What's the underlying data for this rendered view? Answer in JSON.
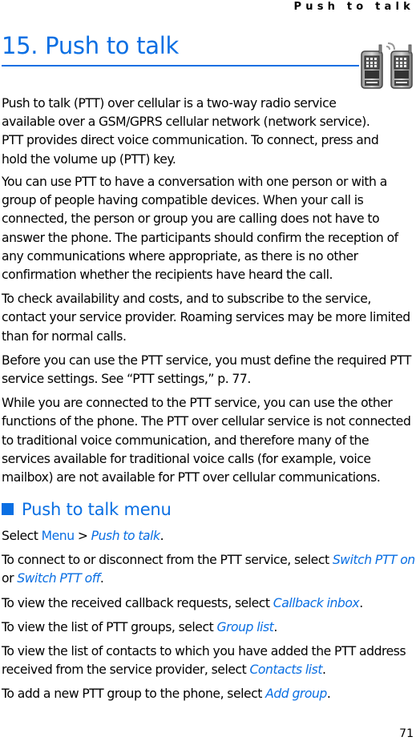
{
  "running_header": "Push to talk",
  "chapter": {
    "number": "15.",
    "title": "Push to talk",
    "icon": "ptt-walkie-talkies-icon"
  },
  "intro_paragraphs": [
    "Push to talk (PTT) over cellular is a two-way radio service available over a GSM/GPRS cellular network (network service). PTT provides direct voice communication. To connect, press and hold the volume up (PTT) key.",
    "You can use PTT to have a conversation with one person or with a group of people having compatible devices. When your call is connected, the person or group you are calling does not have to answer the phone. The participants should confirm the reception of any communications where appropriate, as there is no other confirmation whether the recipients have heard the call.",
    "To check availability and costs, and to subscribe to the service, contact your service provider. Roaming services may be more limited than for normal calls.",
    "Before you can use the PTT service, you must define the required PTT service settings. See “PTT settings,” p. 77.",
    "While you are connected to the PTT service, you can use the other functions of the phone. The PTT over cellular service is not connected to traditional voice communication, and therefore many of the services available for traditional voice calls (for example, voice mailbox) are not available for PTT over cellular communications."
  ],
  "section": {
    "title": "Push to talk menu",
    "select_line": {
      "prefix": "Select ",
      "menu": "Menu",
      "sep": " > ",
      "item": "Push to talk",
      "suffix": "."
    },
    "items": [
      {
        "text": "To connect to or disconnect from the PTT service, select ",
        "option": "Switch PTT on",
        "mid": " or ",
        "option2": "Switch PTT off",
        "suffix": "."
      },
      {
        "text": "To view the received callback requests, select ",
        "option": "Callback inbox",
        "suffix": "."
      },
      {
        "text": "To view the list of PTT groups, select ",
        "option": "Group list",
        "suffix": "."
      },
      {
        "text": "To view the list of contacts to which you have added the PTT address received from the service provider, select ",
        "option": "Contacts list",
        "suffix": "."
      },
      {
        "text": "To add a new PTT group to the phone, select ",
        "option": "Add group",
        "suffix": "."
      }
    ]
  },
  "page_number": "71",
  "colors": {
    "accent": "#0a6fe3",
    "text": "#000000"
  }
}
